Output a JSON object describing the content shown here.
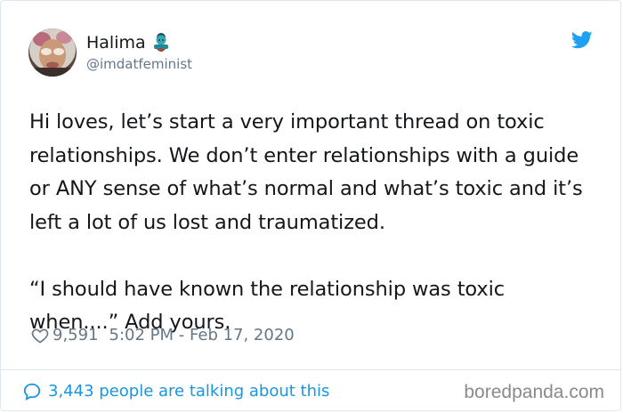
{
  "author": {
    "display_name": "Halima",
    "handle": "@imdatfeminist",
    "avatar_icon": "profile-avatar",
    "emoji_icon": "woman-genie-emoji"
  },
  "tweet": {
    "text": "Hi loves, let’s start a very important thread on toxic relationships. We don’t enter relationships with a guide or ANY sense of what’s normal and what’s toxic and it’s left a lot of us lost and traumatized.\n\n“I should have known the relationship was toxic when....” Add yours.",
    "likes": "9,591",
    "timestamp": "5:02 PM - Feb 17, 2020"
  },
  "footer": {
    "conversation_text": "3,443 people are talking about this"
  },
  "watermark": {
    "text": "boredpanda.com"
  },
  "colors": {
    "twitter_blue": "#1da1f2",
    "link_blue": "#1b95e0",
    "secondary_text": "#657786",
    "border": "#e1e8ed"
  },
  "icons": [
    "twitter-bird-icon",
    "heart-icon",
    "speech-bubble-icon"
  ]
}
